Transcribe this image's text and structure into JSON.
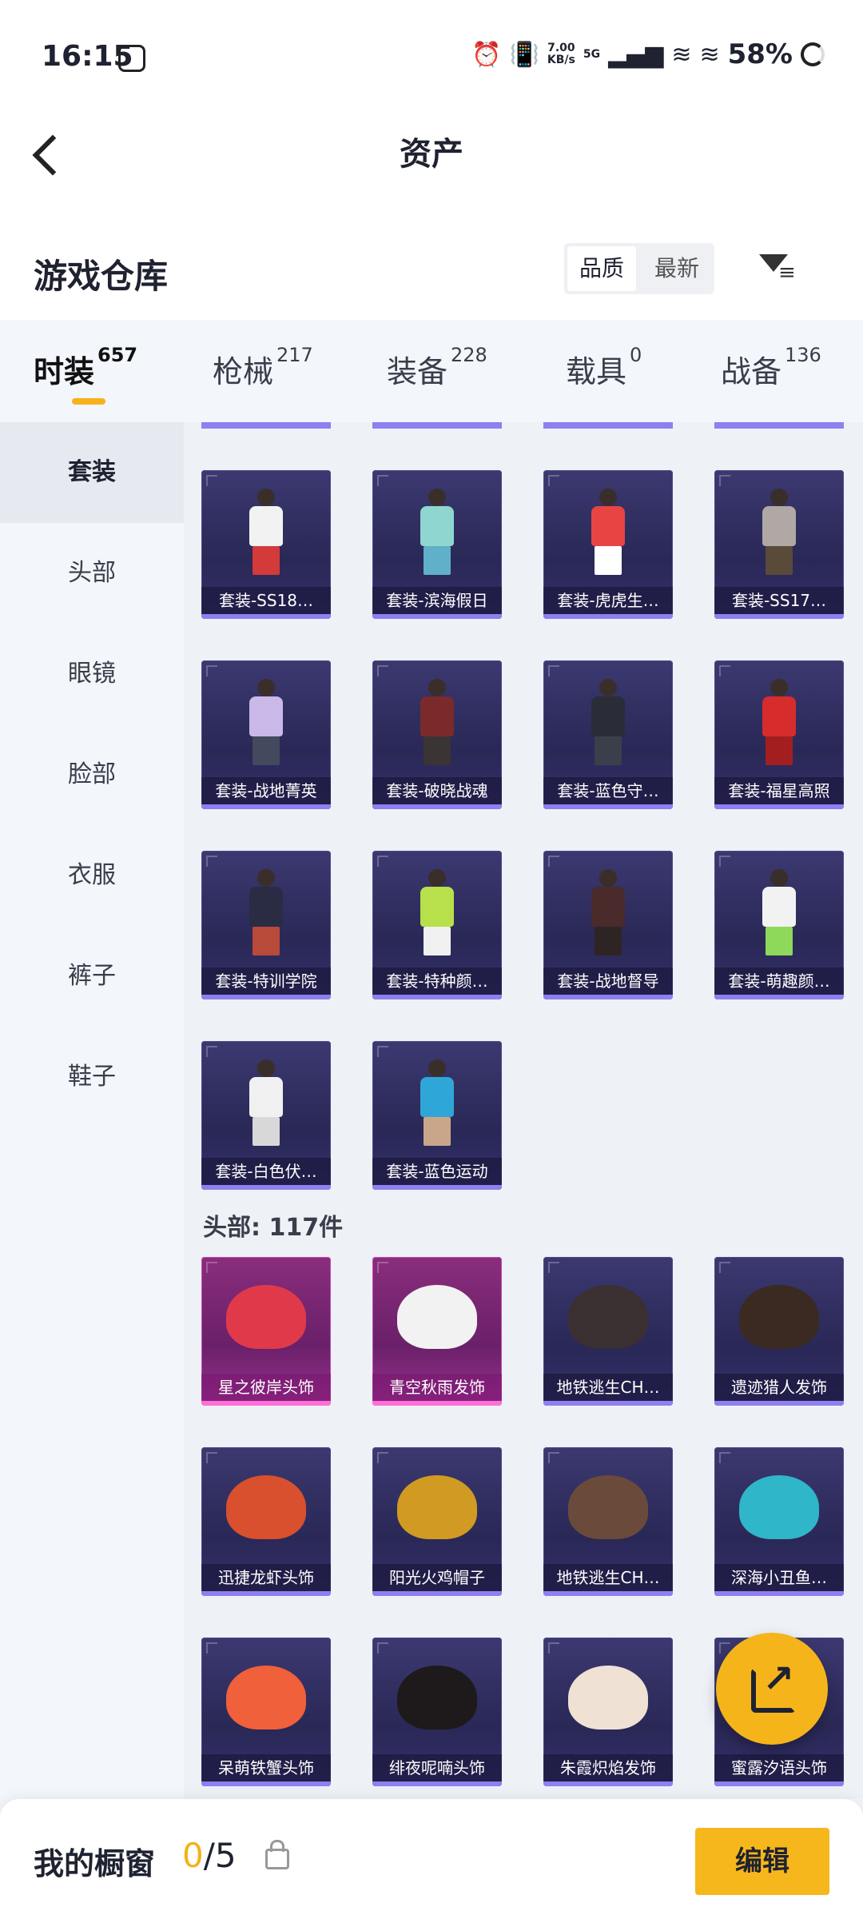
{
  "status_bar": {
    "time": "16:15",
    "network_speed_value": "7.00",
    "network_speed_unit": "KB/s",
    "network_type": "5G",
    "battery": "58%"
  },
  "nav": {
    "title": "资产"
  },
  "warehouse": {
    "title": "游戏仓库",
    "sort_quality": "品质",
    "sort_latest": "最新"
  },
  "tabs": [
    {
      "label": "时装",
      "count": "657",
      "active": true
    },
    {
      "label": "枪械",
      "count": "217"
    },
    {
      "label": "装备",
      "count": "228"
    },
    {
      "label": "载具",
      "count": "0"
    },
    {
      "label": "战备",
      "count": "136"
    }
  ],
  "sidebar": [
    {
      "label": "套装",
      "active": true
    },
    {
      "label": "头部"
    },
    {
      "label": "眼镜"
    },
    {
      "label": "脸部"
    },
    {
      "label": "衣服"
    },
    {
      "label": "裤子"
    },
    {
      "label": "鞋子"
    }
  ],
  "suits": [
    {
      "label": "套装-SS18…",
      "colors": [
        "#f2f2f2",
        "#d33a3a"
      ]
    },
    {
      "label": "套装-滨海假日",
      "colors": [
        "#8fd6d0",
        "#5fb0c8"
      ]
    },
    {
      "label": "套装-虎虎生…",
      "colors": [
        "#e84444",
        "#ffffff"
      ]
    },
    {
      "label": "套装-SS17…",
      "colors": [
        "#b0a8a4",
        "#5a4a3a"
      ]
    },
    {
      "label": "套装-战地菁英",
      "colors": [
        "#c9b8e8",
        "#444a5e"
      ]
    },
    {
      "label": "套装-破晓战魂",
      "colors": [
        "#7a2a2a",
        "#3a3434"
      ]
    },
    {
      "label": "套装-蓝色守…",
      "colors": [
        "#2a2d38",
        "#3a3f4c"
      ]
    },
    {
      "label": "套装-福星高照",
      "colors": [
        "#d62c2c",
        "#a31f1f"
      ]
    },
    {
      "label": "套装-特训学院",
      "colors": [
        "#2a2c44",
        "#b84a3a"
      ]
    },
    {
      "label": "套装-特种颜…",
      "colors": [
        "#b8e04a",
        "#f0f0f0"
      ]
    },
    {
      "label": "套装-战地督导",
      "colors": [
        "#4a2a2a",
        "#2e2424"
      ]
    },
    {
      "label": "套装-萌趣颜…",
      "colors": [
        "#f2f2f2",
        "#8ed85a"
      ]
    },
    {
      "label": "套装-白色伏…",
      "colors": [
        "#f0f0f0",
        "#d8d8d8"
      ]
    },
    {
      "label": "套装-蓝色运动",
      "colors": [
        "#2fa6d8",
        "#c9a68a"
      ]
    }
  ],
  "head_section_title": "头部: 117件",
  "head_items": [
    {
      "label": "星之彼岸头饰",
      "pink": true,
      "color": "#e03a4a"
    },
    {
      "label": "青空秋雨发饰",
      "pink": true,
      "color": "#f2f2f2"
    },
    {
      "label": "地铁逃生CH…",
      "color": "#3a3032"
    },
    {
      "label": "遗迹猎人发饰",
      "color": "#3b2a22"
    },
    {
      "label": "迅捷龙虾头饰",
      "color": "#d8502e"
    },
    {
      "label": "阳光火鸡帽子",
      "color": "#d19a22"
    },
    {
      "label": "地铁逃生CH…",
      "color": "#6a4a3a"
    },
    {
      "label": "深海小丑鱼…",
      "color": "#2fb6c8"
    },
    {
      "label": "呆萌铁蟹头饰",
      "color": "#f0603a"
    },
    {
      "label": "绯夜呢喃头饰",
      "color": "#1e1a1c"
    },
    {
      "label": "朱霞炽焰发饰",
      "color": "#efe2d4"
    },
    {
      "label": "蜜露汐语头饰",
      "color": "#e8d2b8"
    }
  ],
  "bottom": {
    "label": "我的橱窗",
    "count_current": "0",
    "count_total": "/5",
    "edit_label": "编辑"
  },
  "colors": {
    "accent": "#f6b71c",
    "card_bg": "#2a2856",
    "card_pink": "#8a2d7c"
  }
}
